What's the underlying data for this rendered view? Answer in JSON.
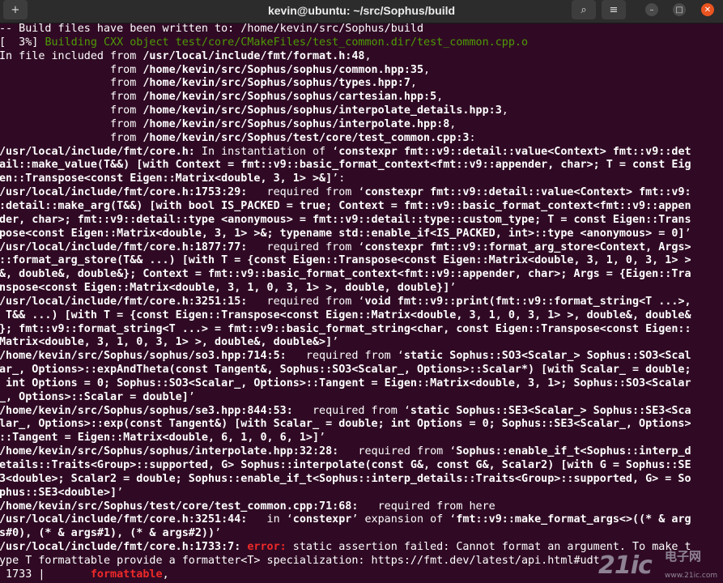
{
  "window": {
    "title": "kevin@ubuntu: ~/src/Sophus/build",
    "new_tab_glyph": "+",
    "search_glyph": "⌕",
    "menu_glyph": "≡",
    "minimize_glyph": "–",
    "maximize_glyph": "□",
    "close_glyph": "✕"
  },
  "terminal": {
    "lines": [
      [
        {
          "t": "-- Build files have been written to: /home/kevin/src/Sophus/build"
        }
      ],
      [
        {
          "t": "[  3%] "
        },
        {
          "t": "Building CXX object test/core/CMakeFiles/test_common.dir/test_common.cpp.o",
          "c": "g"
        }
      ],
      [
        {
          "t": "In file included from "
        },
        {
          "t": "/usr/local/include/fmt/format.h:48",
          "c": "b"
        },
        {
          "t": ","
        }
      ],
      [
        {
          "t": "                 from "
        },
        {
          "t": "/home/kevin/src/Sophus/sophus/common.hpp:35",
          "c": "b"
        },
        {
          "t": ","
        }
      ],
      [
        {
          "t": "                 from "
        },
        {
          "t": "/home/kevin/src/Sophus/sophus/types.hpp:7",
          "c": "b"
        },
        {
          "t": ","
        }
      ],
      [
        {
          "t": "                 from "
        },
        {
          "t": "/home/kevin/src/Sophus/sophus/cartesian.hpp:5",
          "c": "b"
        },
        {
          "t": ","
        }
      ],
      [
        {
          "t": "                 from "
        },
        {
          "t": "/home/kevin/src/Sophus/sophus/interpolate_details.hpp:3",
          "c": "b"
        },
        {
          "t": ","
        }
      ],
      [
        {
          "t": "                 from "
        },
        {
          "t": "/home/kevin/src/Sophus/sophus/interpolate.hpp:8",
          "c": "b"
        },
        {
          "t": ","
        }
      ],
      [
        {
          "t": "                 from "
        },
        {
          "t": "/home/kevin/src/Sophus/test/core/test_common.cpp:3",
          "c": "b"
        },
        {
          "t": ":"
        }
      ],
      [
        {
          "t": "/usr/local/include/fmt/core.h:",
          "c": "b"
        },
        {
          "t": " In instantiation of ‘"
        },
        {
          "t": "constexpr fmt::v9::detail::value<Context> fmt::v9::det",
          "c": "b"
        }
      ],
      [
        {
          "t": "ail::make_value(T&&) [with Context = fmt::v9::basic_format_context<fmt::v9::appender, char>; T = const Eig",
          "c": "b"
        }
      ],
      [
        {
          "t": "en::Transpose<const Eigen::Matrix<double, 3, 1> >&]",
          "c": "b"
        },
        {
          "t": "’:"
        }
      ],
      [
        {
          "t": "/usr/local/include/fmt/core.h:1753:29:",
          "c": "b"
        },
        {
          "t": "   required from ‘"
        },
        {
          "t": "constexpr fmt::v9::detail::value<Context> fmt::v9:",
          "c": "b"
        }
      ],
      [
        {
          "t": ":detail::make_arg(T&&) [with bool IS_PACKED = true; Context = fmt::v9::basic_format_context<fmt::v9::appen",
          "c": "b"
        }
      ],
      [
        {
          "t": "der, char>; fmt::v9::detail::type <anonymous> = fmt::v9::detail::type::custom_type; T = const Eigen::Trans",
          "c": "b"
        }
      ],
      [
        {
          "t": "pose<const Eigen::Matrix<double, 3, 1> >&; typename std::enable_if<IS_PACKED, int>::type <anonymous> = 0]",
          "c": "b"
        },
        {
          "t": "’"
        }
      ],
      [
        {
          "t": "/usr/local/include/fmt/core.h:1877:77:",
          "c": "b"
        },
        {
          "t": "   required from ‘"
        },
        {
          "t": "constexpr fmt::v9::format_arg_store<Context, Args>",
          "c": "b"
        }
      ],
      [
        {
          "t": "::format_arg_store(T&& ...) [with T = {const Eigen::Transpose<const Eigen::Matrix<double, 3, 1, 0, 3, 1> >",
          "c": "b"
        }
      ],
      [
        {
          "t": "&, double&, double&}; Context = fmt::v9::basic_format_context<fmt::v9::appender, char>; Args = {Eigen::Tra",
          "c": "b"
        }
      ],
      [
        {
          "t": "nspose<const Eigen::Matrix<double, 3, 1, 0, 3, 1> >, double, double}]",
          "c": "b"
        },
        {
          "t": "’"
        }
      ],
      [
        {
          "t": "/usr/local/include/fmt/core.h:3251:15:",
          "c": "b"
        },
        {
          "t": "   required from ‘"
        },
        {
          "t": "void fmt::v9::print(fmt::v9::format_string<T ...>,",
          "c": "b"
        }
      ],
      [
        {
          "t": " T&& ...) [with T = {const Eigen::Transpose<const Eigen::Matrix<double, 3, 1, 0, 3, 1> >, double&, double&",
          "c": "b"
        }
      ],
      [
        {
          "t": "}; fmt::v9::format_string<T ...> = fmt::v9::basic_format_string<char, const Eigen::Transpose<const Eigen::",
          "c": "b"
        }
      ],
      [
        {
          "t": "Matrix<double, 3, 1, 0, 3, 1> >, double&, double&>]",
          "c": "b"
        },
        {
          "t": "’"
        }
      ],
      [
        {
          "t": "/home/kevin/src/Sophus/sophus/so3.hpp:714:5:",
          "c": "b"
        },
        {
          "t": "   required from ‘"
        },
        {
          "t": "static Sophus::SO3<Scalar_> Sophus::SO3<Scal",
          "c": "b"
        }
      ],
      [
        {
          "t": "ar_, Options>::expAndTheta(const Tangent&, Sophus::SO3<Scalar_, Options>::Scalar*) [with Scalar_ = double;",
          "c": "b"
        }
      ],
      [
        {
          "t": " int Options = 0; Sophus::SO3<Scalar_, Options>::Tangent = Eigen::Matrix<double, 3, 1>; Sophus::SO3<Scalar",
          "c": "b"
        }
      ],
      [
        {
          "t": "_, Options>::Scalar = double]",
          "c": "b"
        },
        {
          "t": "’"
        }
      ],
      [
        {
          "t": "/home/kevin/src/Sophus/sophus/se3.hpp:844:53:",
          "c": "b"
        },
        {
          "t": "   required from ‘"
        },
        {
          "t": "static Sophus::SE3<Scalar_> Sophus::SE3<Sca",
          "c": "b"
        }
      ],
      [
        {
          "t": "lar_, Options>::exp(const Tangent&) [with Scalar_ = double; int Options = 0; Sophus::SE3<Scalar_, Options>",
          "c": "b"
        }
      ],
      [
        {
          "t": "::Tangent = Eigen::Matrix<double, 6, 1, 0, 6, 1>]",
          "c": "b"
        },
        {
          "t": "’"
        }
      ],
      [
        {
          "t": "/home/kevin/src/Sophus/sophus/interpolate.hpp:32:28:",
          "c": "b"
        },
        {
          "t": "   required from ‘"
        },
        {
          "t": "Sophus::enable_if_t<Sophus::interp_d",
          "c": "b"
        }
      ],
      [
        {
          "t": "etails::Traits<Group>::supported, G> Sophus::interpolate(const G&, const G&, Scalar2) [with G = Sophus::SE",
          "c": "b"
        }
      ],
      [
        {
          "t": "3<double>; Scalar2 = double; Sophus::enable_if_t<Sophus::interp_details::Traits<Group>::supported, G> = So",
          "c": "b"
        }
      ],
      [
        {
          "t": "phus::SE3<double>]",
          "c": "b"
        },
        {
          "t": "’"
        }
      ],
      [
        {
          "t": "/home/kevin/src/Sophus/test/core/test_common.cpp:71:68:",
          "c": "b"
        },
        {
          "t": "   required from here"
        }
      ],
      [
        {
          "t": "/usr/local/include/fmt/core.h:3251:44:",
          "c": "b"
        },
        {
          "t": "   in ‘"
        },
        {
          "t": "constexpr",
          "c": "b"
        },
        {
          "t": "’ expansion of ‘"
        },
        {
          "t": "fmt::v9::make_format_args<>((* & arg",
          "c": "b"
        }
      ],
      [
        {
          "t": "s#0), (* & args#1), (* & args#2))",
          "c": "b"
        },
        {
          "t": "’"
        }
      ],
      [
        {
          "t": "/usr/local/include/fmt/core.h:1733:7:",
          "c": "b"
        },
        {
          "t": " "
        },
        {
          "t": "error: ",
          "c": "r"
        },
        {
          "t": "static assertion failed: Cannot format an argument. To make t"
        }
      ],
      [
        {
          "t": "ype T formattable provide a formatter<T> specialization: https://fmt.dev/latest/api.html#udt"
        }
      ],
      [
        {
          "t": " 1733 |       "
        },
        {
          "t": "formattable",
          "c": "r"
        },
        {
          "t": ","
        }
      ]
    ]
  },
  "watermark": {
    "logo": "21ic",
    "chinese": "电子网",
    "url": "www.21ic.com"
  }
}
